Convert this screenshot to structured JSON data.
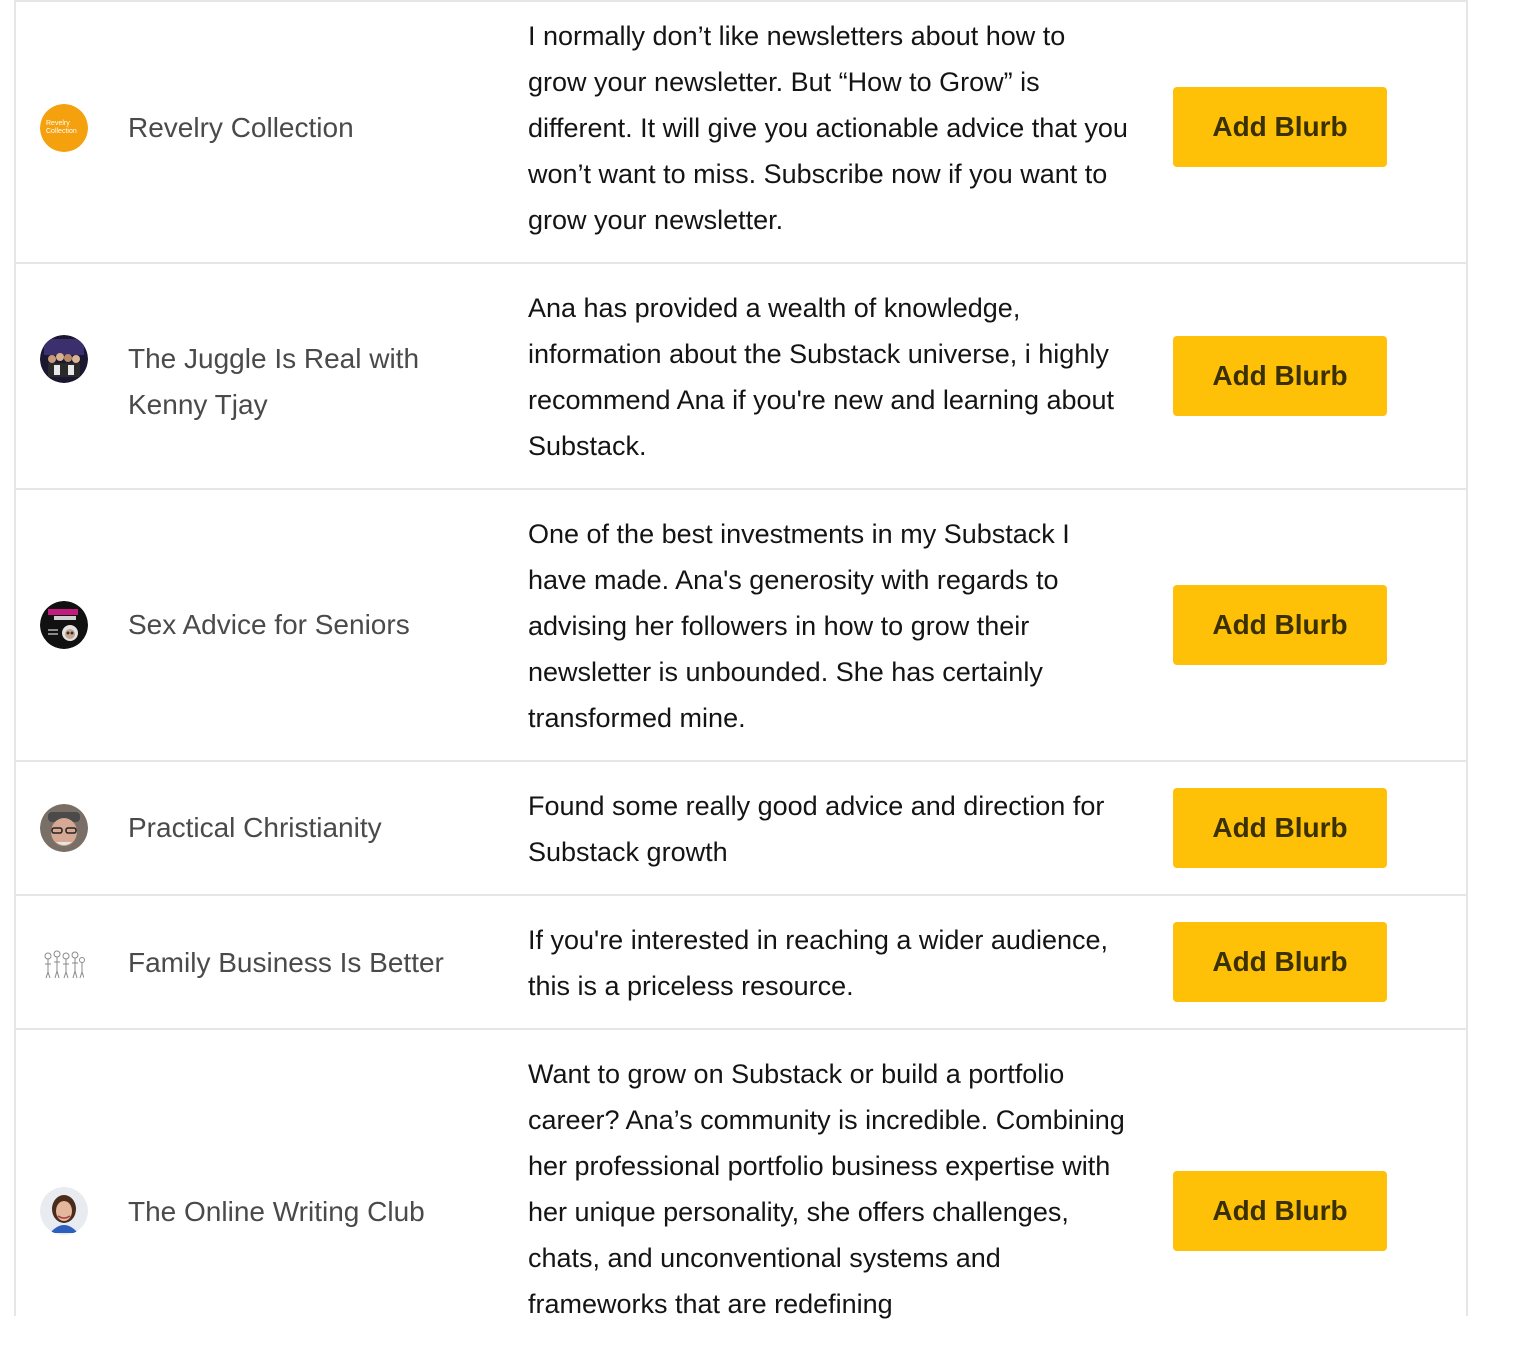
{
  "accent_color": "#ffc107",
  "rows": [
    {
      "avatar_icon": "revelry-collection-logo",
      "avatar_text": "Revelry Collection",
      "publication": "Revelry Collection",
      "blurb": "I normally don’t like newsletters about how to grow your newsletter. But “How to Grow” is different. It will give you actionable advice that you won’t want to miss. Subscribe now if you want to grow your newsletter.",
      "button_label": "Add Blurb"
    },
    {
      "avatar_icon": "group-photo-avatar",
      "publication": "The Juggle Is Real with Kenny Tjay",
      "blurb": "Ana has provided a wealth of knowledge, information about the Substack universe, i highly recommend Ana if you're new and learning about Substack.",
      "button_label": "Add Blurb"
    },
    {
      "avatar_icon": "sex-advice-for-seniors-logo",
      "publication": "Sex Advice for Seniors",
      "blurb": "One of the best investments in my Substack I have made. Ana's generosity with regards to advising her followers in how to grow their newsletter is unbounded. She has certainly transformed mine.",
      "button_label": "Add Blurb"
    },
    {
      "avatar_icon": "man-portrait-avatar",
      "publication": "Practical Christianity",
      "blurb": "Found some really good advice and direction for Substack growth",
      "button_label": "Add Blurb"
    },
    {
      "avatar_icon": "family-sketch-avatar",
      "publication": "Family Business Is Better",
      "blurb": "If you're interested in reaching a wider audience, this is a priceless resource.",
      "button_label": "Add Blurb"
    },
    {
      "avatar_icon": "woman-portrait-avatar",
      "publication": "The Online Writing Club",
      "blurb": "Want to grow on Substack or build a portfolio career? Ana’s community is incredible. Combining her professional portfolio business expertise with her unique personality, she offers challenges, chats, and unconventional systems and frameworks that are redefining",
      "button_label": "Add Blurb"
    }
  ]
}
